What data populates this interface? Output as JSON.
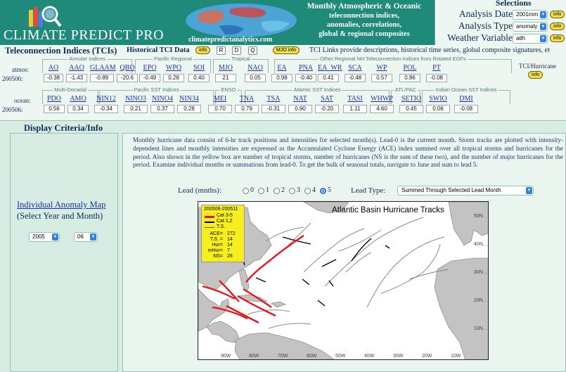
{
  "header": {
    "app_title": "CLIMATE PREDICT PRO",
    "site_url": "climatepredictanalytics.com",
    "tagline": [
      "Monthly Atmospheric & Oceanic",
      "teleconnection indices,",
      "anomalies, correlations,",
      "global & regional composites"
    ]
  },
  "selections": {
    "title": "Selections",
    "analysis_date_label": "Analysis Date",
    "analysis_date_value": "2001mm",
    "analysis_type_label": "Analysis Type",
    "analysis_type_value": "anomaly",
    "weather_variable_label": "Weather Variable",
    "weather_variable_value": "atlh",
    "info_label": "info"
  },
  "tci": {
    "title": "Teleconnection Indices (TCIs)",
    "historical_label": "Historical TCI Data",
    "info_label": "info",
    "buttons": [
      "R",
      "D",
      "Q"
    ],
    "mjo_info": "MJO info",
    "links_text": "TCI Links provide descriptions, historical time series, global composite signatures, et",
    "hurricane_label": "TCI/Hurricane",
    "row1": {
      "row_label": "atmos:",
      "date_label": "200506:",
      "groups": [
        "Annular Indices",
        "Pacific Regional",
        "Tropical",
        "Other Regional NH Teleconnection Indices from Rotated EOFs"
      ],
      "indices": [
        "AO",
        "AAO",
        "GLAAM",
        "QBO",
        "EPO",
        "WPO",
        "SOI",
        "MJO",
        "NAO",
        "EA",
        "PNA",
        "EA_WR",
        "SCA",
        "WP",
        "POL",
        "PT"
      ],
      "values": [
        "-0.38",
        "-1.43",
        "-0.89",
        "-20.6",
        "-0.49",
        "0.28",
        "0.40",
        "21",
        "0.05",
        "0.98",
        "-0.40",
        "0.41",
        "-0.48",
        "0.57",
        "0.86",
        "-0.08"
      ]
    },
    "row2": {
      "row_label": "ocean:",
      "date_label": "200506:",
      "groups": [
        "Multi-Decadal",
        "Pacific SST Indices",
        "ENSO",
        "Atlantic SST Indices",
        "ATL/PAC",
        "Indian Ocean SST Indices"
      ],
      "indices": [
        "PDO",
        "AMO",
        "NIN12",
        "NINO3",
        "NINO4",
        "NIN34",
        "MEI",
        "TNA",
        "TSA",
        "NAT",
        "SAT",
        "TASI",
        "WHWP",
        "SETIO",
        "SWIO",
        "DMI"
      ],
      "values": [
        "0.56",
        "0.34",
        "-0.34",
        "0.21",
        "0.37",
        "0.28",
        "0.70",
        "0.79",
        "-0.31",
        "0.90",
        "-0.20",
        "1.11",
        "4.60",
        "0.45",
        "0.06",
        "-0.08"
      ]
    }
  },
  "left": {
    "display_criteria": "Display Criteria/Info",
    "anomaly_map_link": "Individual Anomaly Map",
    "anomaly_map_sub": "(Select Year and Month)",
    "year_value": "2005",
    "month_value": "06"
  },
  "right": {
    "description": "Monthly hurricane data consist of 6-hr track positions and intensities for selected month(s). Lead-0 is the current month. Storm tracks are plotted with intensity-dependent lines and monthly intensities are expressed as the Accumulated Cyclone Energy (ACE) index summed over all tropical storms and hurricanes for the period. Also shown in the yellow box are number of tropical storms, number of hurricanes (NS is the sum of these two), and the number of major hurricanes for the period. Examine individual months or summations from lead-0. To get the bulk of seasonal totals, navigate to June and sum to lead 5.",
    "lead_label": "Lead (mnths):",
    "lead_options": [
      "0",
      "1",
      "2",
      "3",
      "4",
      "5"
    ],
    "lead_selected": 5,
    "lead_type_label": "Lead Type:",
    "lead_type_value": "Summed Through Selected Lead Month"
  },
  "map": {
    "title": "Atlantic Basin Hurricane Tracks",
    "legend": {
      "period": "200506-200511",
      "categories": [
        {
          "label": "Cat 3-5",
          "color": "#e8151b"
        },
        {
          "label": "Cat 1,2",
          "color": "#000000"
        },
        {
          "label": "T.S.",
          "color": "#555555"
        }
      ],
      "stats": [
        {
          "key": "ACE=",
          "value": "272"
        },
        {
          "key": "T.S. =",
          "value": "14"
        },
        {
          "key": "Hur=",
          "value": "14"
        },
        {
          "key": "mHur=",
          "value": "7"
        },
        {
          "key": "NS=",
          "value": "28"
        }
      ]
    },
    "lat_labels": [
      "50N",
      "40N",
      "30N",
      "20N",
      "10N"
    ],
    "lon_labels": [
      "90W",
      "80W",
      "70W",
      "60W",
      "50W",
      "40W",
      "30W",
      "20W",
      "10W"
    ],
    "colors": {
      "land": "#c3c3c3",
      "major": "#e8151b",
      "hurricane": "#000000",
      "storm": "#8a8a8a"
    }
  }
}
